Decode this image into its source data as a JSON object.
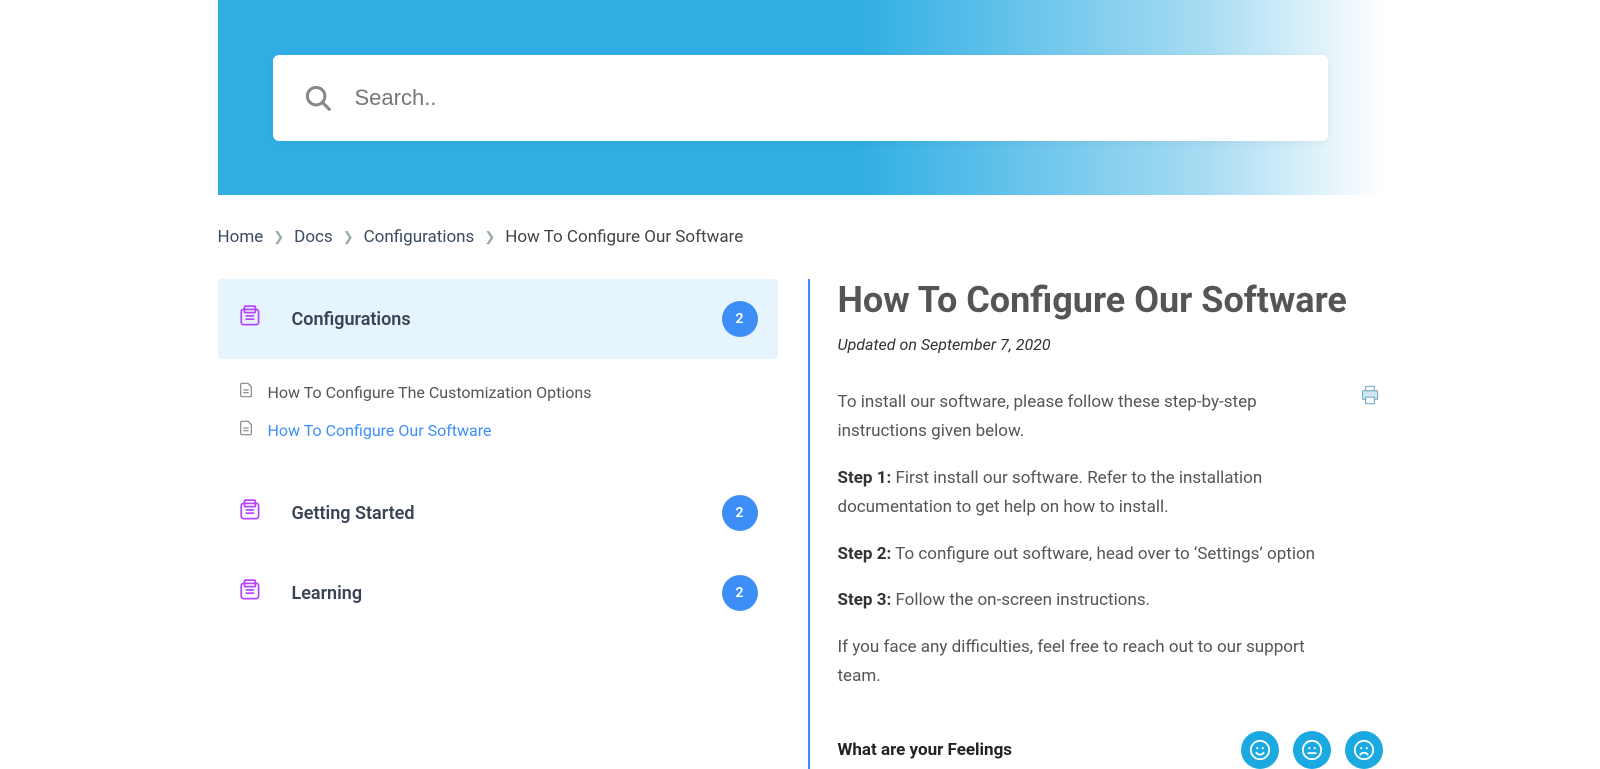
{
  "search": {
    "placeholder": "Search.."
  },
  "breadcrumb": {
    "home": "Home",
    "docs": "Docs",
    "configs": "Configurations",
    "current": "How To Configure Our Software"
  },
  "sidebar": {
    "categories": [
      {
        "label": "Configurations",
        "count": "2"
      },
      {
        "label": "Getting Started",
        "count": "2"
      },
      {
        "label": "Learning",
        "count": "2"
      }
    ],
    "subitems": [
      {
        "label": "How To Configure The Customization Options"
      },
      {
        "label": "How To Configure Our Software"
      }
    ]
  },
  "article": {
    "title": "How To Configure Our Software",
    "updated": "Updated on September 7, 2020",
    "intro": "To install our software, please follow these step-by-step instructions given below.",
    "step1_label": "Step 1:",
    "step1_text": " First install our software. Refer to the installation documentation to get help on how to install.",
    "step2_label": "Step 2:",
    "step2_text": " To configure out software, head over to ‘Settings’ option",
    "step3_label": "Step 3:",
    "step3_text": " Follow the on-screen instructions.",
    "outro": "If you face any difficulties, feel free to reach out to our support team.",
    "feelings_label": "What are your Feelings"
  }
}
